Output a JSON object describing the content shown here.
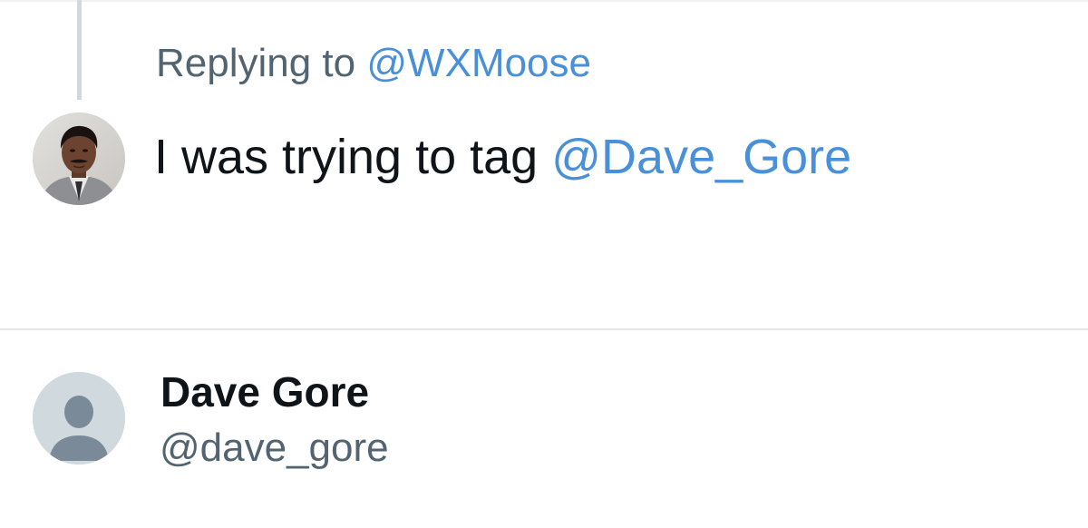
{
  "reply_context": {
    "prefix": "Replying to",
    "mention": "@WXMoose"
  },
  "tweet": {
    "text": "I was trying to tag",
    "mention": "@Dave_Gore",
    "avatar_icon": "user-photo-avatar"
  },
  "suggested_user": {
    "display_name": "Dave Gore",
    "handle": "@dave_gore",
    "avatar_icon": "default-profile-icon"
  },
  "colors": {
    "link": "#4a90d9",
    "secondary_text": "#536471",
    "primary_text": "#0f1419",
    "thread_line": "#cfd9de",
    "divider": "#e1e6ea",
    "default_avatar_bg": "#cfd9de",
    "default_avatar_fg": "#7a8a99"
  }
}
